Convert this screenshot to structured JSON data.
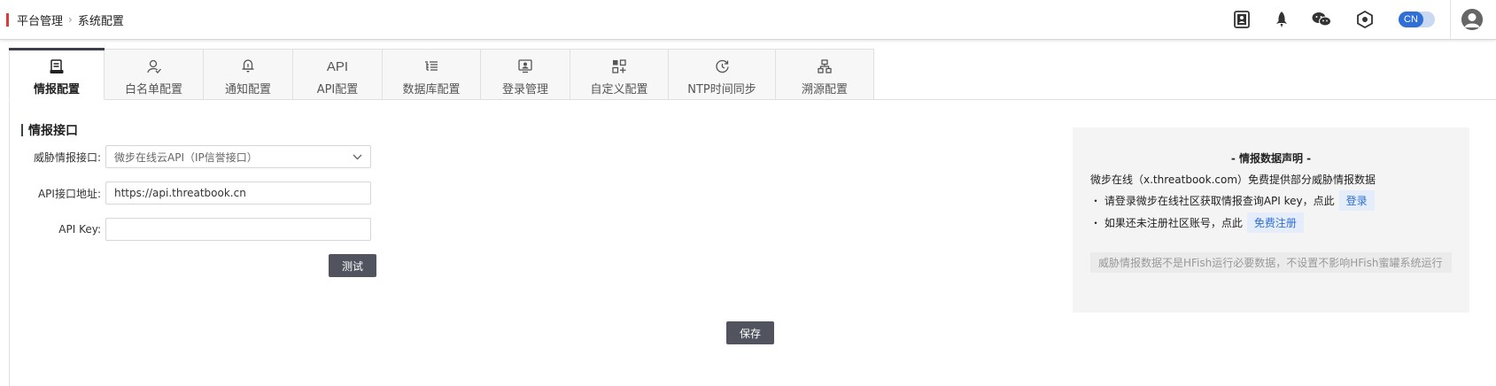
{
  "breadcrumb": {
    "root": "平台管理",
    "separator": "›",
    "current": "系统配置"
  },
  "header_icons": [
    "user-guide-icon",
    "rocket-icon",
    "wechat-icon",
    "hexagon-settings-icon"
  ],
  "language_toggle": {
    "value": "CN"
  },
  "tabs": [
    {
      "label": "情报配置",
      "icon": "intel-icon",
      "active": true
    },
    {
      "label": "白名单配置",
      "icon": "whitelist-icon"
    },
    {
      "label": "通知配置",
      "icon": "bell-icon"
    },
    {
      "label": "API配置",
      "icon_text": "API"
    },
    {
      "label": "数据库配置",
      "icon": "database-icon"
    },
    {
      "label": "登录管理",
      "icon": "login-icon"
    },
    {
      "label": "自定义配置",
      "icon": "custom-grid-icon"
    },
    {
      "label": "NTP时间同步",
      "icon": "clock-sync-icon"
    },
    {
      "label": "溯源配置",
      "icon": "trace-icon"
    }
  ],
  "section": {
    "title": "情报接口"
  },
  "form": {
    "threat_api": {
      "label": "威胁情报接口:",
      "value": "微步在线云API（IP信誉接口）"
    },
    "api_url": {
      "label": "API接口地址:",
      "value": "https://api.threatbook.cn"
    },
    "api_key": {
      "label": "API Key:",
      "value": ""
    },
    "test_button": "测试",
    "save_button": "保存"
  },
  "notice": {
    "title": "- 情报数据声明 -",
    "line1": "微步在线（x.threatbook.com）免费提供部分威胁情报数据",
    "line2_text": "・ 请登录微步在线社区获取情报查询API key，点此",
    "line2_link": "登录",
    "line3_text": "・ 如果还未注册社区账号，点此",
    "line3_link": "免费注册",
    "hint": "威胁情报数据不是HFish运行必要数据，不设置不影响HFish蜜罐系统运行"
  },
  "colors": {
    "accent": "#e2383a",
    "dark_button": "#51545e",
    "link": "#2f6fd6",
    "toggle": "#2f6fd6"
  }
}
